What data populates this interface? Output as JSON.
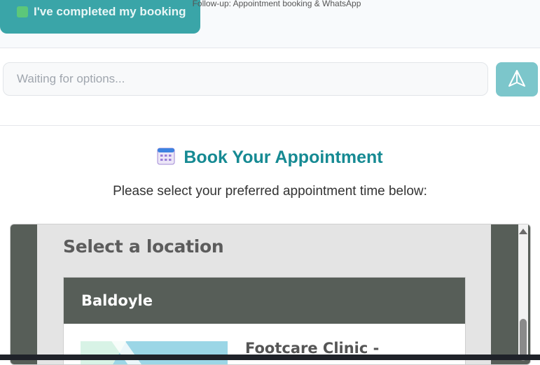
{
  "caption": "Follow-up: Appointment booking & WhatsApp",
  "completed_button": {
    "label": "I've completed my booking"
  },
  "chat": {
    "placeholder": "Waiting for options...",
    "send_icon": "send-icon"
  },
  "booking": {
    "icon": "calendar-icon",
    "title": "Book Your Appointment",
    "subtitle": "Please select your preferred appointment time below:"
  },
  "widget": {
    "heading": "Select a location",
    "locations": [
      {
        "name": "Baldoyle",
        "clinic": "Footcare Clinic -"
      }
    ]
  },
  "colors": {
    "accent": "#168a93",
    "button": "#3aa5a8",
    "send_button": "#7cc6cb",
    "widget_dark": "#575e58"
  }
}
